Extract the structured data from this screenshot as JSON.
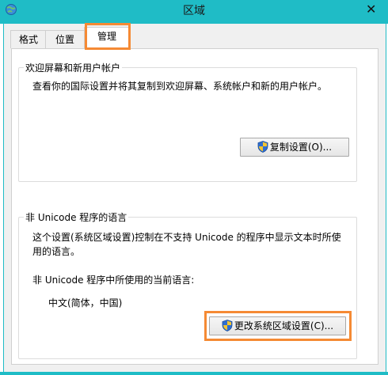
{
  "window": {
    "title": "区域",
    "close_symbol": "✕",
    "app_icon": "region-globe-icon",
    "accent_color": "#1fbcc6"
  },
  "tabs": [
    {
      "label": "格式",
      "selected": false
    },
    {
      "label": "位置",
      "selected": false
    },
    {
      "label": "管理",
      "selected": true
    }
  ],
  "highlight_color": "#f58a34",
  "welcome_group": {
    "legend": "欢迎屏幕和新用户帐户",
    "description": "查看你的国际设置并将其复制到欢迎屏幕、系统帐户和新的用户帐户。",
    "button_label": "复制设置(O)...",
    "button_icon": "uac-shield-icon"
  },
  "unicode_group": {
    "legend": "非 Unicode 程序的语言",
    "description_line1": "这个设置(系统区域设置)控制在不支持 Unicode 的程序中显示文本时所使",
    "description_line2": "用的语言。",
    "current_label": "非 Unicode 程序中所使用的当前语言:",
    "current_value": "中文(简体，中国)",
    "button_label": "更改系统区域设置(C)...",
    "button_icon": "uac-shield-icon"
  }
}
